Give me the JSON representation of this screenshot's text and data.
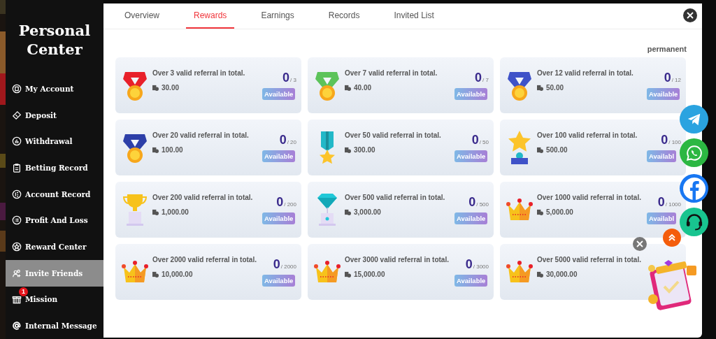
{
  "sidebar": {
    "title": "Personal Center",
    "items": [
      {
        "label": "My Account",
        "selected": false
      },
      {
        "label": "Deposit",
        "selected": false
      },
      {
        "label": "Withdrawal",
        "selected": false
      },
      {
        "label": "Betting Record",
        "selected": false
      },
      {
        "label": "Account Record",
        "selected": false
      },
      {
        "label": "Profit And Loss",
        "selected": false
      },
      {
        "label": "Reward Center",
        "selected": false
      },
      {
        "label": "Invite Friends",
        "selected": true
      },
      {
        "label": "Mission",
        "selected": false,
        "badge": "1"
      },
      {
        "label": "Internal Message",
        "selected": false
      }
    ]
  },
  "tabs": [
    {
      "label": "Overview",
      "selected": false
    },
    {
      "label": "Rewards",
      "selected": true
    },
    {
      "label": "Earnings",
      "selected": false
    },
    {
      "label": "Records",
      "selected": false
    },
    {
      "label": "Invited List",
      "selected": false
    }
  ],
  "period": "permanent",
  "rewards": [
    {
      "kind": "medal",
      "title": "Over 3 valid referral in total.",
      "amount": "30.00",
      "count": "0",
      "target": "/ 3",
      "button": "Available"
    },
    {
      "kind": "medal",
      "title": "Over 7 valid referral in total.",
      "amount": "40.00",
      "count": "0",
      "target": "/ 7",
      "button": "Available"
    },
    {
      "kind": "medal",
      "title": "Over 12 valid referral in total.",
      "amount": "50.00",
      "count": "0",
      "target": "/ 12",
      "button": "Available"
    },
    {
      "kind": "medal",
      "title": "Over 20 valid referral in total.",
      "amount": "100.00",
      "count": "0",
      "target": "/ 20",
      "button": "Available"
    },
    {
      "kind": "ribbon",
      "title": "Over 50 valid referral in total.",
      "amount": "300.00",
      "count": "0",
      "target": "/ 50",
      "button": "Available"
    },
    {
      "kind": "startrophy",
      "title": "Over 100 valid referral in total.",
      "amount": "500.00",
      "count": "0",
      "target": "/ 100",
      "button": "Availabl"
    },
    {
      "kind": "cup",
      "title": "Over 200 valid referral in total.",
      "amount": "1,000.00",
      "count": "0",
      "target": "/ 200",
      "button": "Available"
    },
    {
      "kind": "diamond",
      "title": "Over 500 valid referral in total.",
      "amount": "3,000.00",
      "count": "0",
      "target": "/ 500",
      "button": "Available"
    },
    {
      "kind": "crown",
      "title": "Over 1000 valid referral in total.",
      "amount": "5,000.00",
      "count": "0",
      "target": "/ 1000",
      "button": "Availabl"
    },
    {
      "kind": "crown",
      "title": "Over 2000 valid referral in total.",
      "amount": "10,000.00",
      "count": "0",
      "target": "/ 2000",
      "button": "Available"
    },
    {
      "kind": "crown",
      "title": "Over 3000 valid referral in total.",
      "amount": "15,000.00",
      "count": "0",
      "target": "/ 3000",
      "button": "Available"
    },
    {
      "kind": "crown",
      "title": "Over 5000 valid referral in total.",
      "amount": "30,000.00"
    }
  ],
  "floating": [
    {
      "kind": "telegram"
    },
    {
      "kind": "whatsapp"
    },
    {
      "kind": "facebook"
    },
    {
      "kind": "support"
    }
  ]
}
